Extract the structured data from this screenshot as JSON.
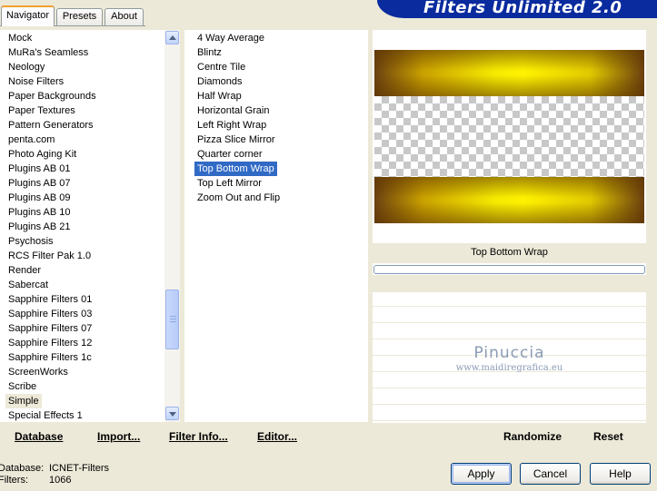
{
  "tabs": [
    {
      "label": "Navigator",
      "active": true
    },
    {
      "label": "Presets",
      "active": false
    },
    {
      "label": "About",
      "active": false
    }
  ],
  "banner": {
    "title": "Filters Unlimited 2.0",
    "color": "#0a2b9e"
  },
  "categories": [
    "Mock",
    "MuRa's Seamless",
    "Neology",
    "Noise Filters",
    "Paper Backgrounds",
    "Paper Textures",
    "Pattern Generators",
    "penta.com",
    "Photo Aging Kit",
    "Plugins AB 01",
    "Plugins AB 07",
    "Plugins AB 09",
    "Plugins AB 10",
    "Plugins AB 21",
    "Psychosis",
    "RCS Filter Pak 1.0",
    "Render",
    "Sabercat",
    "Sapphire Filters 01",
    "Sapphire Filters 03",
    "Sapphire Filters 07",
    "Sapphire Filters 12",
    "Sapphire Filters 1c",
    "ScreenWorks",
    "Scribe",
    "Simple",
    "Special Effects 1"
  ],
  "selected_category": "Simple",
  "filters": [
    "4 Way Average",
    "Blintz",
    "Centre Tile",
    "Diamonds",
    "Half Wrap",
    "Horizontal Grain",
    "Left Right Wrap",
    "Pizza Slice Mirror",
    "Quarter corner",
    "Top Bottom Wrap",
    "Top Left Mirror",
    "Zoom Out and Flip"
  ],
  "selected_filter": "Top Bottom Wrap",
  "preview": {
    "filter_name": "Top Bottom Wrap"
  },
  "watermark": {
    "line1": "Pinuccia",
    "line2": "www.maidiregrafica.eu"
  },
  "actions": {
    "database": "Database",
    "import": "Import...",
    "filter_info": "Filter Info...",
    "editor": "Editor...",
    "randomize": "Randomize",
    "reset": "Reset"
  },
  "info": {
    "database_label": "Database:",
    "database_value": "ICNET-Filters",
    "filters_label": "Filters:",
    "filters_value": "1066"
  },
  "buttons": {
    "apply": "Apply",
    "cancel": "Cancel",
    "help": "Help"
  },
  "colors": {
    "selection": "#316ac5",
    "window_bg": "#ece9d8"
  }
}
